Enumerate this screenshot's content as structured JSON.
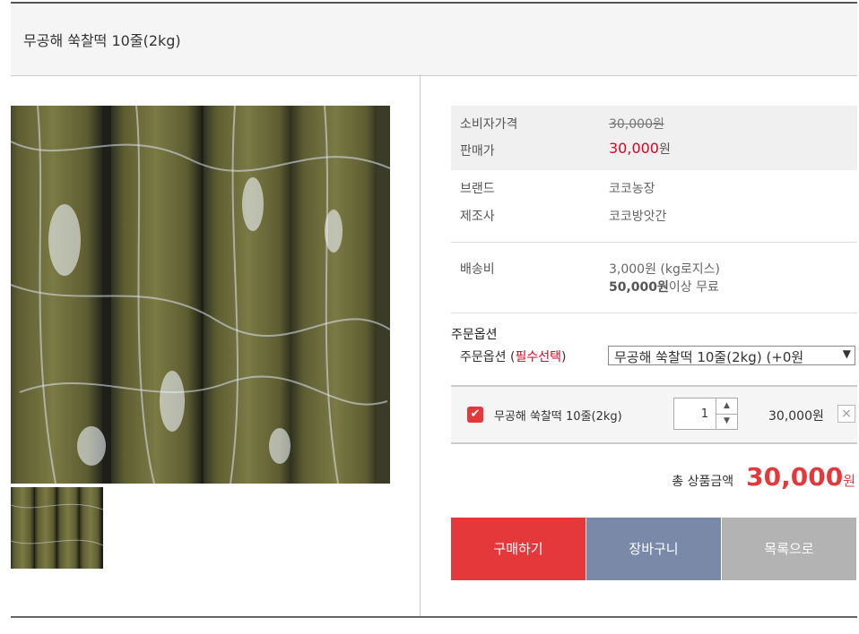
{
  "product": {
    "title": "무공해 쑥찰떡 10줄(2kg)"
  },
  "price": {
    "consumer_label": "소비자가격",
    "consumer_value": "30,000원",
    "sale_label": "판매가",
    "sale_value": "30,000",
    "sale_unit": "원"
  },
  "info": {
    "brand_label": "브랜드",
    "brand_value": "코코농장",
    "maker_label": "제조사",
    "maker_value": "코코방앗간",
    "shipping_label": "배송비",
    "shipping_value": "3,000원 (kg로지스)",
    "free_ship_amount": "50,000원",
    "free_ship_text": "이상 무료"
  },
  "options": {
    "section_title": "주문옵션",
    "option_label": "주문옵션 (",
    "option_required": "필수선택",
    "option_label_close": ")",
    "selected_value": "무공해 쑥찰떡 10줄(2kg) (+0원",
    "arrow": "▼"
  },
  "selected_item": {
    "check": "✔",
    "name": "무공해 쑥찰떡 10줄(2kg)",
    "quantity": "1",
    "up": "▲",
    "down": "▼",
    "price": "30,000원",
    "delete": "×"
  },
  "total": {
    "label": "총 상품금액",
    "amount": "30,000",
    "unit": "원"
  },
  "buttons": {
    "buy": "구매하기",
    "cart": "장바구니",
    "list": "목록으로"
  },
  "colors": {
    "accent_red": "#e5383b",
    "cart_blue": "#7a89a8",
    "list_gray": "#b3b3b3",
    "rice_cake_green": "#6f6e3a"
  }
}
